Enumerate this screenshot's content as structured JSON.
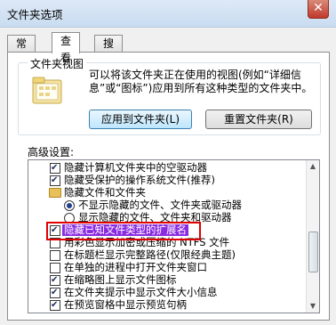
{
  "window": {
    "title": "文件夹选项",
    "close": "✕"
  },
  "tabs": [
    {
      "label": "常规"
    },
    {
      "label": "查看"
    },
    {
      "label": "搜索"
    }
  ],
  "folder_views": {
    "title": "文件夹视图",
    "description": "可以将该文件夹正在使用的视图(例如“详细信息”或“图标”)应用到所有这种类型的文件夹中。",
    "apply_button": "应用到文件夹(L)",
    "reset_button": "重置文件夹(R)"
  },
  "advanced": {
    "label": "高级设置:",
    "items": [
      {
        "kind": "checkbox",
        "checked": true,
        "label": "隐藏计算机文件夹中的空驱动器"
      },
      {
        "kind": "checkbox",
        "checked": true,
        "label": "隐藏受保护的操作系统文件(推荐)"
      },
      {
        "kind": "folder",
        "label": "隐藏文件和文件夹"
      },
      {
        "kind": "radio",
        "checked": true,
        "label": "不显示隐藏的文件、文件夹或驱动器"
      },
      {
        "kind": "radio",
        "checked": false,
        "label": "显示隐藏的文件、文件夹和驱动器"
      },
      {
        "kind": "checkbox",
        "checked": true,
        "label": "隐藏已知文件类型的扩展名"
      },
      {
        "kind": "checkbox",
        "checked": false,
        "label": "用彩色显示加密或压缩的 NTFS 文件"
      },
      {
        "kind": "checkbox",
        "checked": false,
        "label": "在标题栏显示完整路径(仅限经典主题)"
      },
      {
        "kind": "checkbox",
        "checked": false,
        "label": "在单独的进程中打开文件夹窗口"
      },
      {
        "kind": "checkbox",
        "checked": true,
        "label": "在缩略图上显示文件图标"
      },
      {
        "kind": "checkbox",
        "checked": true,
        "label": "在文件夹提示中显示文件大小信息"
      },
      {
        "kind": "checkbox",
        "checked": true,
        "label": "在预览窗格中显示预览句柄"
      }
    ]
  }
}
